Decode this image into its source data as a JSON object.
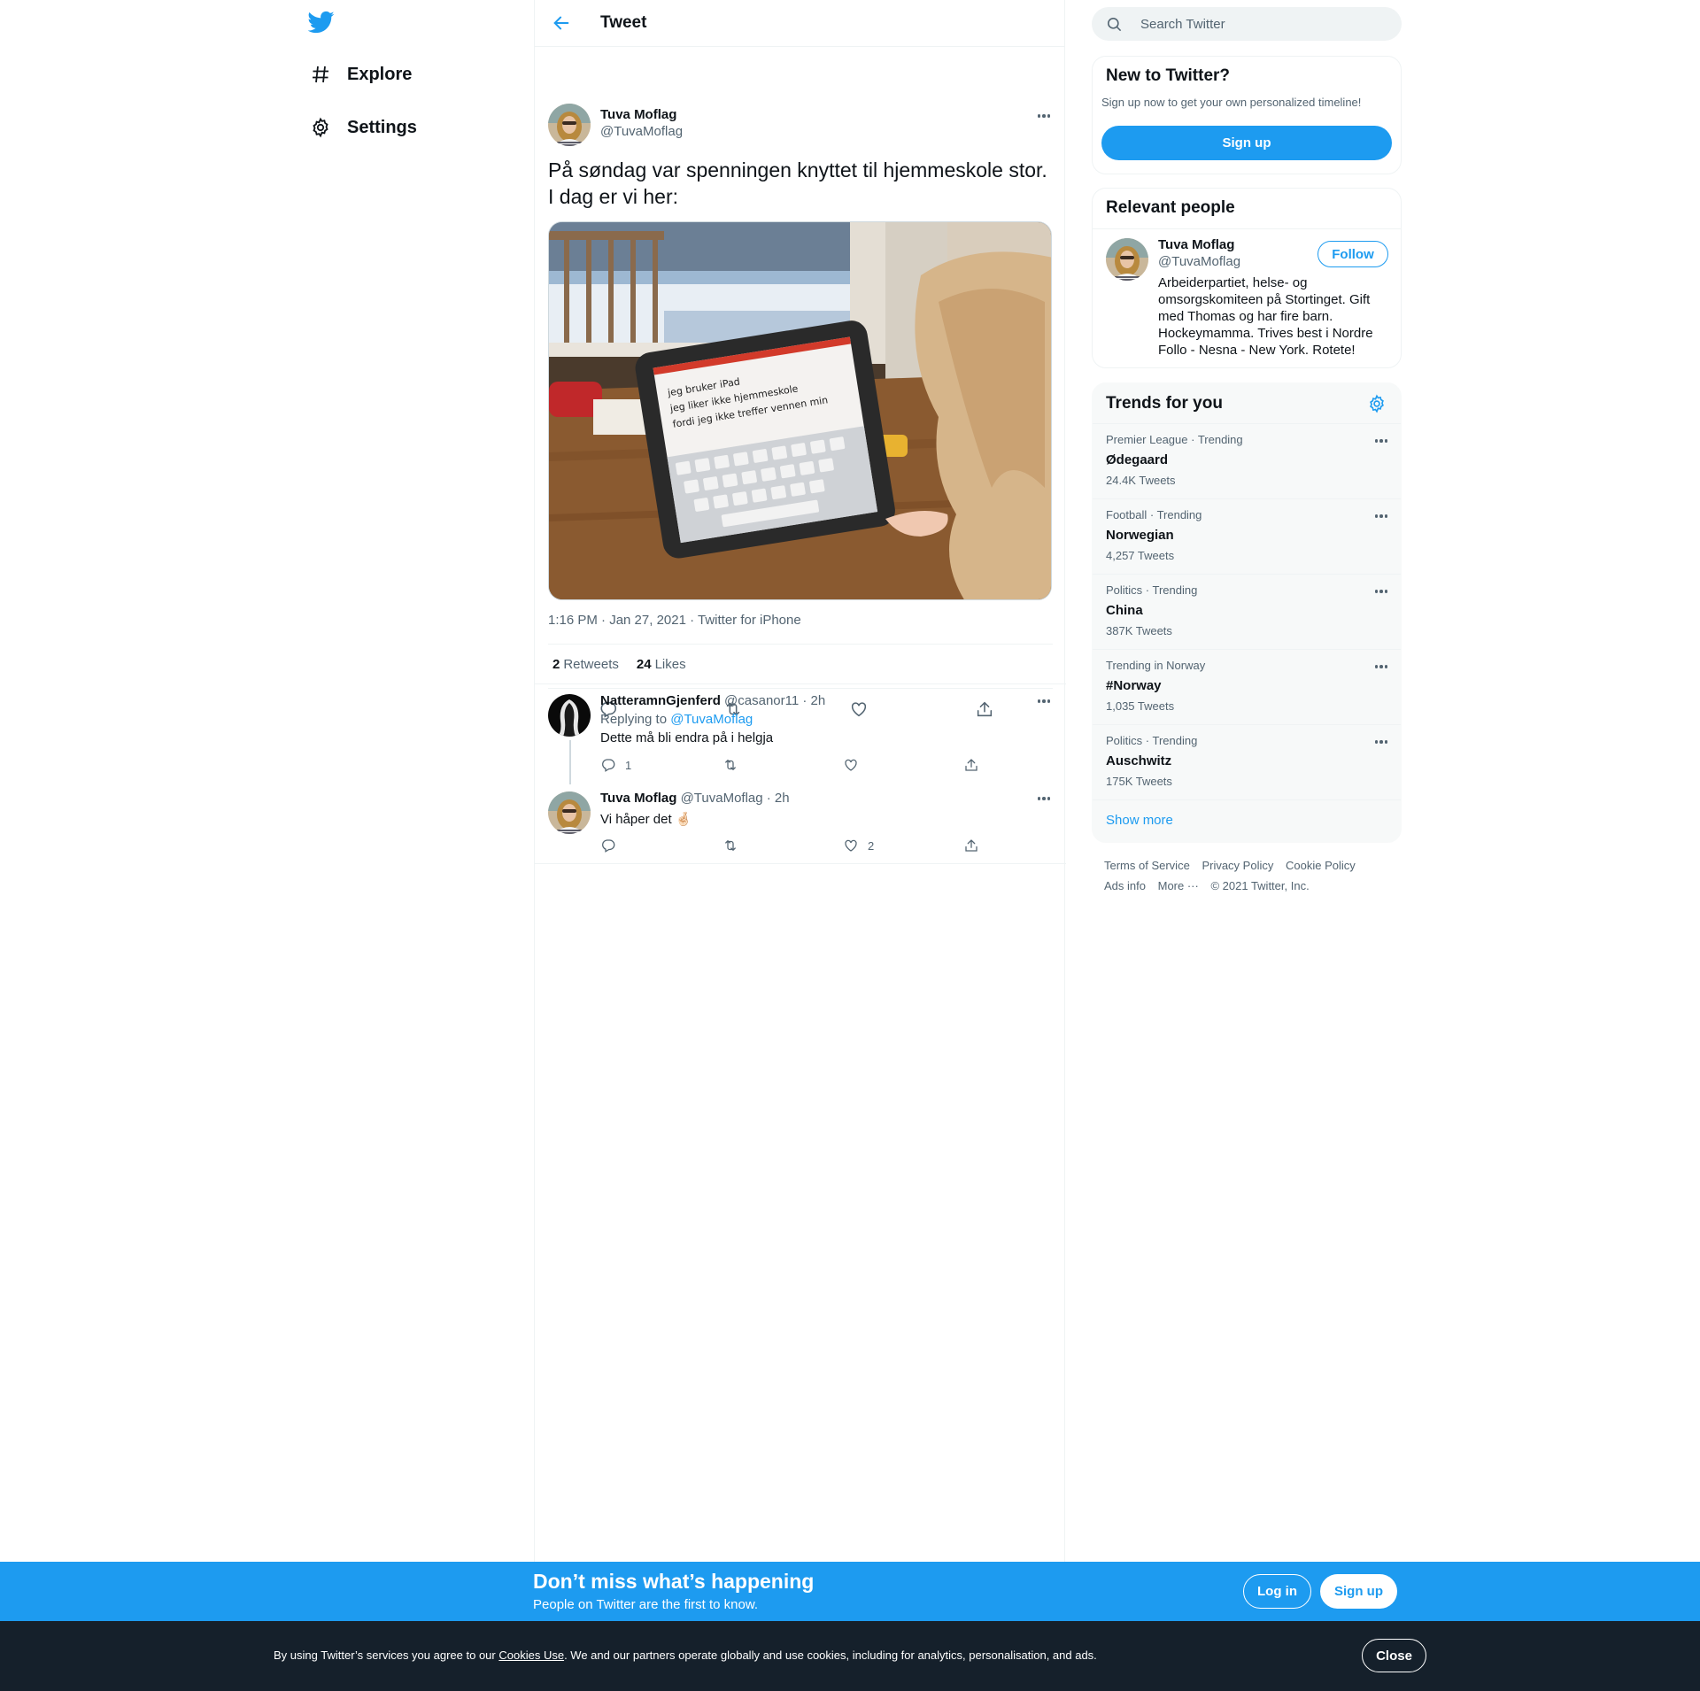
{
  "nav": {
    "logo_icon": "twitter-bird-icon",
    "items": [
      {
        "label": "Explore",
        "icon": "hashtag-icon"
      },
      {
        "label": "Settings",
        "icon": "gear-icon"
      }
    ]
  },
  "header": {
    "title": "Tweet",
    "back_icon": "arrow-left-icon"
  },
  "tweet": {
    "author_name": "Tuva Moflag",
    "author_handle": "@TuvaMoflag",
    "text_line1": "På søndag var spenningen knyttet til hjemmeskole stor.",
    "text_line2": "I dag er vi her:",
    "ipad_lines": [
      "jeg bruker iPad",
      "jeg liker ikke hjemmeskole",
      "fordi jeg ikke treffer vennen min"
    ],
    "timestamp": "1:16 PM · Jan 27, 2021 · Twitter for iPhone",
    "retweets_count": "2",
    "retweets_label": "Retweets",
    "likes_count": "24",
    "likes_label": "Likes"
  },
  "replies": [
    {
      "name": "NatteramnGjenferd",
      "meta": "@casanor11 · 2h",
      "replying_prefix": "Replying to",
      "replying_to": "@TuvaMoflag",
      "text": "Dette må bli endra på i helgja",
      "reply_count": "1",
      "like_count": ""
    },
    {
      "name": "Tuva Moflag",
      "meta": "@TuvaMoflag · 2h",
      "text": "Vi håper det 🤞🏻",
      "reply_count": "",
      "like_count": "2"
    }
  ],
  "sidebar": {
    "search_placeholder": "Search Twitter",
    "new_title": "New to Twitter?",
    "new_sub": "Sign up now to get your own personalized timeline!",
    "signup_label": "Sign up",
    "relevant_title": "Relevant people",
    "person": {
      "name": "Tuva Moflag",
      "handle": "@TuvaMoflag",
      "follow_label": "Follow",
      "bio_lines": [
        "Arbeiderpartiet, helse- og",
        "omsorgskomiteen på Stortinget. Gift",
        "med Thomas og har fire barn.",
        "Hockeymamma. Trives best i Nordre",
        "Follo - Nesna - New York. Rotete!"
      ]
    },
    "trends_title": "Trends for you",
    "trends": [
      {
        "context": "Premier League · Trending",
        "name": "Ødegaard",
        "count": "24.4K Tweets"
      },
      {
        "context": "Football · Trending",
        "name": "Norwegian",
        "count": "4,257 Tweets"
      },
      {
        "context": "Politics · Trending",
        "name": "China",
        "count": "387K Tweets"
      },
      {
        "context": "Trending in Norway",
        "name": "#Norway",
        "count": "1,035 Tweets"
      },
      {
        "context": "Politics · Trending",
        "name": "Auschwitz",
        "count": "175K Tweets"
      }
    ],
    "show_more": "Show more",
    "footer": {
      "terms": "Terms of Service",
      "privacy": "Privacy Policy",
      "cookie": "Cookie Policy",
      "ads": "Ads info",
      "more": "More ···",
      "copyright": "© 2021 Twitter, Inc."
    }
  },
  "promo": {
    "title": "Don’t miss what’s happening",
    "subtitle": "People on Twitter are the first to know.",
    "login_label": "Log in",
    "signup_label": "Sign up"
  },
  "cookie": {
    "prefix": "By using Twitter’s services you agree to our",
    "link": "Cookies Use",
    "suffix": ". We and our partners operate globally and use cookies, including for analytics, personalisation, and ads.",
    "close_label": "Close"
  },
  "colors": {
    "accent": "#1d9bf0",
    "text": "#0f1419",
    "secondary": "#536471",
    "cookie_bg": "#15202b"
  }
}
